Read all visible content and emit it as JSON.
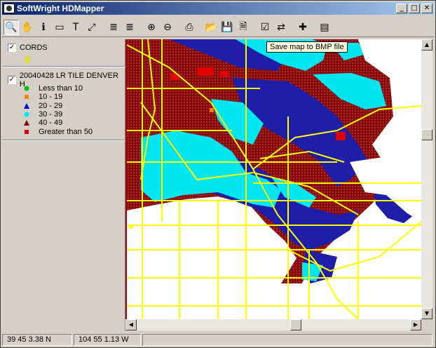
{
  "window": {
    "title": "SoftWright HDMapper"
  },
  "title_buttons": {
    "minimize": "_",
    "maximize": "□",
    "close": "✕"
  },
  "toolbar": {
    "tools": [
      {
        "name": "zoom-tool-icon",
        "glyph": "🔍",
        "pressed": true
      },
      {
        "name": "pan-hand-icon",
        "glyph": "✋"
      },
      {
        "name": "info-icon",
        "glyph": "ℹ"
      },
      {
        "name": "label-tool-icon",
        "glyph": "▭"
      },
      {
        "name": "text-tool-icon",
        "glyph": "T"
      },
      {
        "name": "measure-line-icon",
        "glyph": "⤢"
      },
      {
        "name": "layers-up-icon",
        "glyph": "≣"
      },
      {
        "name": "layers-down-icon",
        "glyph": "≣"
      },
      {
        "name": "zoom-in-icon",
        "glyph": "⊕"
      },
      {
        "name": "zoom-out-icon",
        "glyph": "⊖"
      },
      {
        "name": "print-icon",
        "glyph": "⎙"
      },
      {
        "name": "open-folder-icon",
        "glyph": "📂"
      },
      {
        "name": "save-icon",
        "glyph": "💾"
      },
      {
        "name": "save-bmp-icon",
        "glyph": "🗎"
      },
      {
        "name": "properties-icon",
        "glyph": "☑"
      },
      {
        "name": "export-icon",
        "glyph": "⇄"
      },
      {
        "name": "add-layer-icon",
        "glyph": "✚"
      },
      {
        "name": "window-icon",
        "glyph": "▤"
      }
    ],
    "tooltip": "Save map to BMP file"
  },
  "legend": {
    "layers": [
      {
        "label": "CORDS",
        "checked": "✓"
      },
      {
        "label": "20040428 LR TILE DENVER H",
        "checked": "✓"
      }
    ],
    "entries": [
      {
        "label": "Less than 10",
        "color": "#00c000",
        "shape": "circle"
      },
      {
        "label": "10 - 19",
        "color": "#ff7f00",
        "shape": "square"
      },
      {
        "label": "20 - 29",
        "color": "#0000c0",
        "shape": "triangle"
      },
      {
        "label": "30 - 39",
        "color": "#00e5ff",
        "shape": "circle"
      },
      {
        "label": "40 - 49",
        "color": "#800000",
        "shape": "triangle"
      },
      {
        "label": "Greater than 50",
        "color": "#e00000",
        "shape": "square"
      }
    ]
  },
  "status": {
    "lat": "39 45 3.38 N",
    "lon": "104 55 1.13 W"
  },
  "colors": {
    "maroon": "#8b0a0a",
    "blue": "#1e1ea8",
    "cyan": "#00e6f0",
    "road": "#ffff00",
    "red": "#e00000"
  }
}
